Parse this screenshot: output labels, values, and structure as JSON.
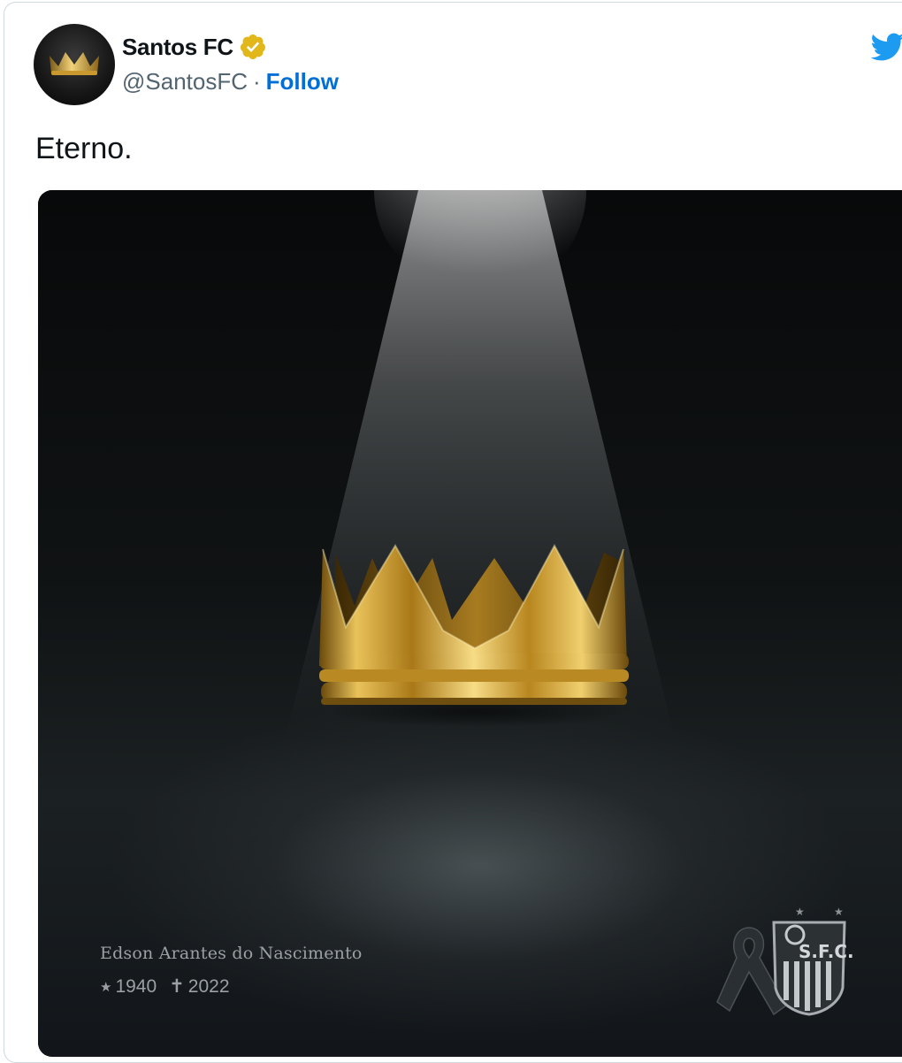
{
  "author": {
    "display_name": "Santos FC",
    "handle": "@SantosFC",
    "separator": "·",
    "follow_label": "Follow"
  },
  "tweet": {
    "text": "Eterno."
  },
  "media": {
    "caption_name": "Edson Arantes do Nascimento",
    "birth_symbol": "★",
    "birth_year": "1940",
    "death_symbol": "✝",
    "death_year": "2022",
    "crest_text": "S.F.C."
  },
  "icons": {
    "verified": "verified-badge-icon",
    "brand": "twitter-bird-icon",
    "crown": "crown-icon",
    "mourning": "mourning-ribbon-icon"
  },
  "colors": {
    "follow": "#006fd6",
    "verified": "#e2b719",
    "twitter": "#1d9bf0",
    "gold": "#d4a93c"
  }
}
